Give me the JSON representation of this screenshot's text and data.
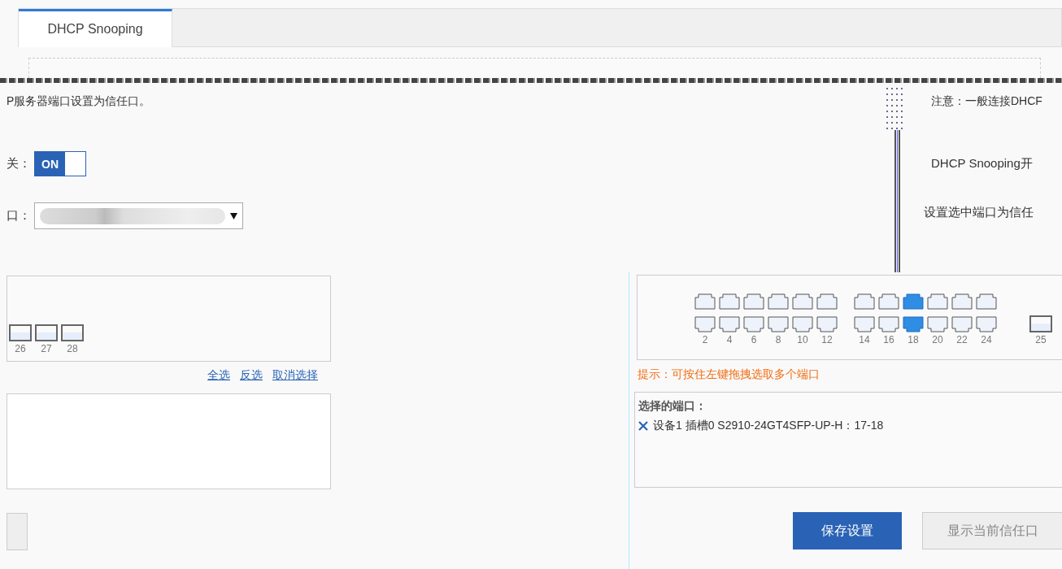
{
  "tabs": [
    {
      "label": "DHCP Snooping",
      "selected": true
    }
  ],
  "left": {
    "note": "P服务器端口设置为信任口。",
    "switch": {
      "label": "关：",
      "on": true,
      "text": "ON"
    },
    "port_select": {
      "label": "口："
    },
    "ports": [
      {
        "label": "26",
        "selected": false
      },
      {
        "label": "27",
        "selected": false
      },
      {
        "label": "28",
        "selected": false
      }
    ],
    "links": [
      "全选",
      "反选",
      "取消选择"
    ]
  },
  "right": {
    "note": "注意：一般连接DHCF",
    "switch_label": "DHCP Snooping开",
    "trust_label": "设置选中端口为信任"
  },
  "port_panel": {
    "top_ports": [
      {
        "selected": false
      },
      {
        "selected": false
      },
      {
        "selected": false
      },
      {
        "selected": false
      },
      {
        "selected": false
      },
      {
        "selected": false
      },
      {
        "selected": false
      },
      {
        "selected": false
      },
      {
        "selected": true
      },
      {
        "selected": false
      },
      {
        "selected": false
      },
      {
        "selected": false
      }
    ],
    "bottom_ports": [
      {
        "label": "2",
        "selected": false
      },
      {
        "label": "4",
        "selected": false
      },
      {
        "label": "6",
        "selected": false
      },
      {
        "label": "8",
        "selected": false
      },
      {
        "label": "10",
        "selected": false
      },
      {
        "label": "12",
        "selected": false
      },
      {
        "label": "14",
        "selected": false
      },
      {
        "label": "16",
        "selected": false
      },
      {
        "label": "18",
        "selected": true
      },
      {
        "label": "20",
        "selected": false
      },
      {
        "label": "22",
        "selected": false
      },
      {
        "label": "24",
        "selected": false
      }
    ],
    "sfp_port": {
      "label": "25",
      "selected": false
    }
  },
  "hint": "提示：可按住左键拖拽选取多个端口",
  "selected_ports": {
    "title": "选择的端口：",
    "items": [
      "设备1 插槽0 S2910-24GT4SFP-UP-H：17-18"
    ]
  },
  "buttons": [
    {
      "label": "保存设置",
      "kind": "primary"
    },
    {
      "label": "显示当前信任口",
      "kind": "secondary"
    }
  ]
}
